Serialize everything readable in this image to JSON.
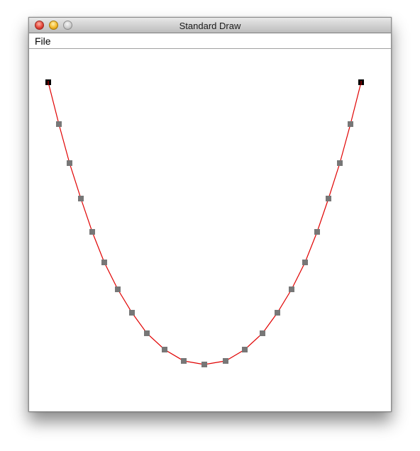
{
  "window": {
    "title": "Standard Draw"
  },
  "menu": {
    "file_label": "File"
  },
  "colors": {
    "curve": "#e00000",
    "interior_point": "#777777",
    "endpoint": "#000000"
  },
  "icons": {
    "close": "close-icon",
    "minimize": "minimize-icon",
    "zoom": "zoom-icon"
  }
}
